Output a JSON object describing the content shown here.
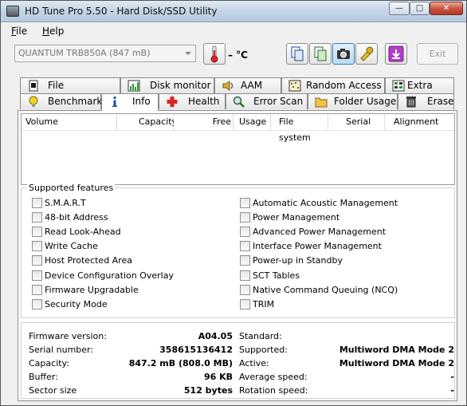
{
  "window": {
    "title": "HD Tune Pro 5.50 - Hard Disk/SSD Utility"
  },
  "menu": {
    "file": "File",
    "help": "Help"
  },
  "toolbar": {
    "drive": "QUANTUM TRB850A (847 mB)",
    "temperature": "– °C",
    "exit_label": "Exit"
  },
  "tabs_top": [
    {
      "label": "File Benchmark",
      "icon": "file-benchmark-icon"
    },
    {
      "label": "Disk monitor",
      "icon": "disk-monitor-icon"
    },
    {
      "label": "AAM",
      "icon": "speaker-icon"
    },
    {
      "label": "Random Access",
      "icon": "random-access-icon"
    },
    {
      "label": "Extra tests",
      "icon": "extra-tests-icon"
    }
  ],
  "tabs_bottom": [
    {
      "label": "Benchmark",
      "icon": "benchmark-icon"
    },
    {
      "label": "Info",
      "icon": "info-icon",
      "active": true
    },
    {
      "label": "Health",
      "icon": "health-icon"
    },
    {
      "label": "Error Scan",
      "icon": "error-scan-icon"
    },
    {
      "label": "Folder Usage",
      "icon": "folder-icon"
    },
    {
      "label": "Erase",
      "icon": "erase-icon"
    }
  ],
  "volume_table": {
    "columns": [
      "Volume",
      "Capacity",
      "Free",
      "Usage",
      "File system",
      "Serial",
      "Alignment"
    ],
    "rows": []
  },
  "features": {
    "label": "Supported features",
    "left": [
      "S.M.A.R.T",
      "48-bit Address",
      "Read Look-Ahead",
      "Write Cache",
      "Host Protected Area",
      "Device Configuration Overlay",
      "Firmware Upgradable",
      "Security Mode"
    ],
    "right": [
      "Automatic Acoustic Management",
      "Power Management",
      "Advanced Power Management",
      "Interface Power Management",
      "Power-up in Standby",
      "SCT Tables",
      "Native Command Queuing (NCQ)",
      "TRIM"
    ]
  },
  "info": {
    "left": [
      {
        "label": "Firmware version:",
        "value": "A04.05"
      },
      {
        "label": "Serial number:",
        "value": "358615136412"
      },
      {
        "label": "Capacity:",
        "value": "847.2 mB (808.0 MB)"
      },
      {
        "label": "Buffer:",
        "value": "96 KB"
      },
      {
        "label": "Sector size",
        "value": "512 bytes"
      }
    ],
    "right": [
      {
        "label": "Standard:",
        "value": ""
      },
      {
        "label": "Supported:",
        "value": "Multiword DMA Mode 2"
      },
      {
        "label": "Active:",
        "value": "Multiword DMA Mode 2"
      },
      {
        "label": "Average speed:",
        "value": "-"
      },
      {
        "label": "Rotation speed:",
        "value": "-"
      }
    ]
  }
}
